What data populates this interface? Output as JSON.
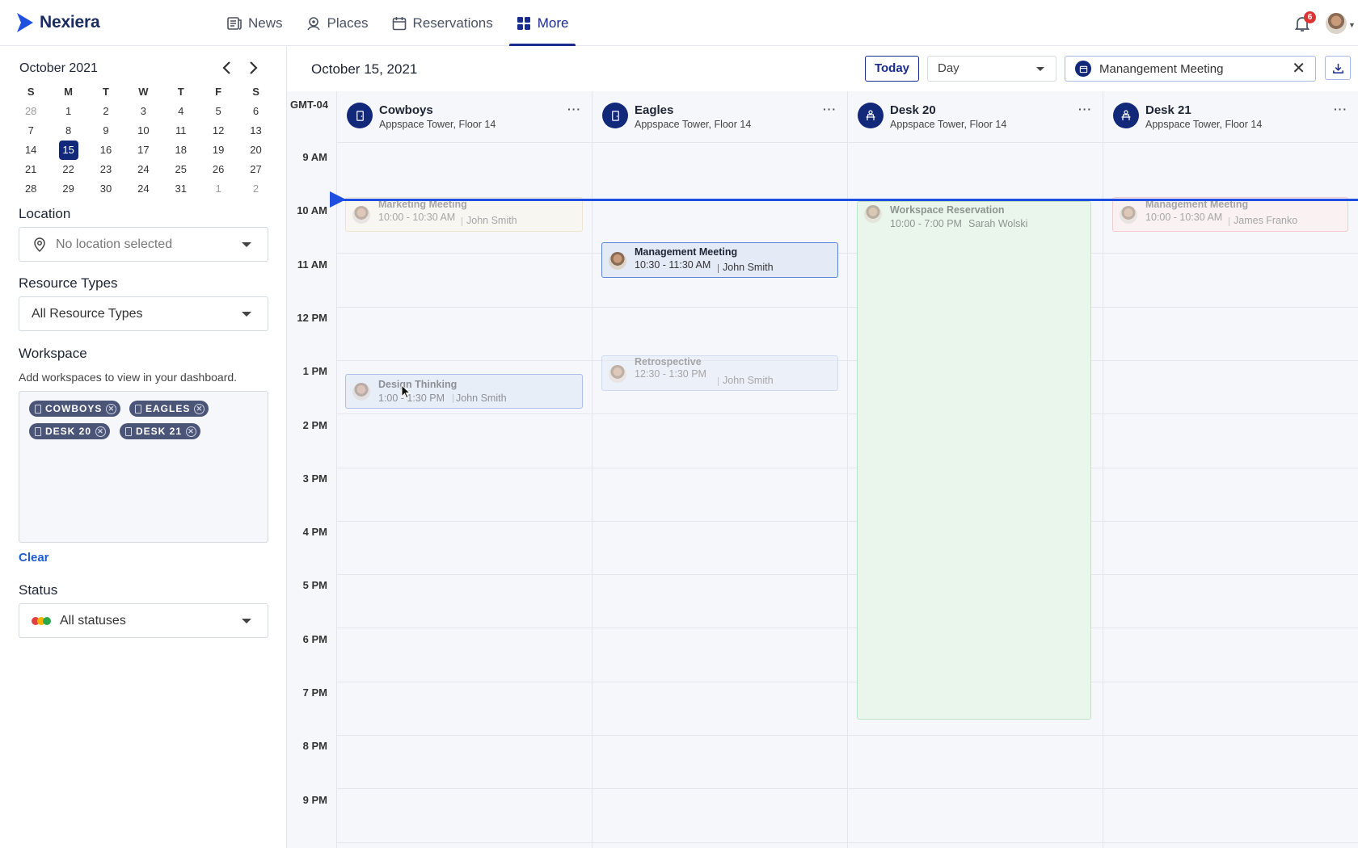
{
  "app": {
    "brand": "Nexiera"
  },
  "nav": {
    "items": [
      {
        "label": "News",
        "icon": "news-icon"
      },
      {
        "label": "Places",
        "icon": "places-icon"
      },
      {
        "label": "Reservations",
        "icon": "calendar-icon"
      },
      {
        "label": "More",
        "icon": "grid-icon",
        "active": true
      }
    ],
    "notifications_count": "6"
  },
  "sidebar": {
    "month_title": "October 2021",
    "weekdays": [
      "S",
      "M",
      "T",
      "W",
      "T",
      "F",
      "S"
    ],
    "days": [
      [
        "28",
        "1",
        "2",
        "3",
        "4",
        "5",
        "6"
      ],
      [
        "7",
        "8",
        "9",
        "10",
        "11",
        "12",
        "13"
      ],
      [
        "14",
        "15",
        "16",
        "17",
        "18",
        "19",
        "20"
      ],
      [
        "21",
        "22",
        "23",
        "24",
        "25",
        "26",
        "27"
      ],
      [
        "28",
        "29",
        "30",
        "24",
        "31",
        "1",
        "2"
      ]
    ],
    "selected_day": "15",
    "location": {
      "label": "Location",
      "placeholder": "No location selected"
    },
    "resource_types": {
      "label": "Resource Types",
      "value": "All Resource Types"
    },
    "workspace": {
      "label": "Workspace",
      "description": "Add workspaces to view in your dashboard.",
      "chips": [
        "COWBOYS",
        "EAGLES",
        "DESK 20",
        "DESK 21"
      ],
      "clear_label": "Clear"
    },
    "status": {
      "label": "Status",
      "value": "All statuses"
    }
  },
  "header": {
    "date": "October 15, 2021",
    "today_label": "Today",
    "view_value": "Day",
    "search_value": "Manangement Meeting"
  },
  "grid": {
    "timezone": "GMT-04",
    "hours": [
      "9 AM",
      "10 AM",
      "11 AM",
      "12 PM",
      "1 PM",
      "2 PM",
      "3 PM",
      "4 PM",
      "5 PM",
      "6 PM",
      "7 PM",
      "8 PM",
      "9 PM"
    ],
    "resources": [
      {
        "name": "Cowboys",
        "location": "Appspace Tower, Floor 14",
        "icon": "room-icon"
      },
      {
        "name": "Eagles",
        "location": "Appspace Tower, Floor 14",
        "icon": "room-icon"
      },
      {
        "name": "Desk 20",
        "location": "Appspace Tower, Floor 14",
        "icon": "desk-icon"
      },
      {
        "name": "Desk 21",
        "location": "Appspace Tower, Floor 14",
        "icon": "desk-icon"
      }
    ],
    "more_label": "···",
    "events": [
      {
        "title": "Marketing Meeting",
        "time": "10:00 - 10:30 AM",
        "person": "John Smith"
      },
      {
        "title": "Management Meeting",
        "time": "10:30 - 11:30 AM",
        "person": "John Smith"
      },
      {
        "title": "Workspace Reservation",
        "time": "10:00 - 7:00 PM",
        "person": "Sarah Wolski"
      },
      {
        "title": "Management Meeting",
        "time": "10:00 - 10:30 AM",
        "person": "James Franko"
      },
      {
        "title": "Retrospective",
        "time": "12:30 - 1:30 PM",
        "person": "John Smith"
      },
      {
        "title": "Design Thinking",
        "time": "1:00 - 1:30 PM",
        "person": "John Smith"
      }
    ]
  },
  "colors": {
    "primary": "#12297a",
    "accent": "#1f4fe0",
    "now_line": "#1f4fe0"
  }
}
